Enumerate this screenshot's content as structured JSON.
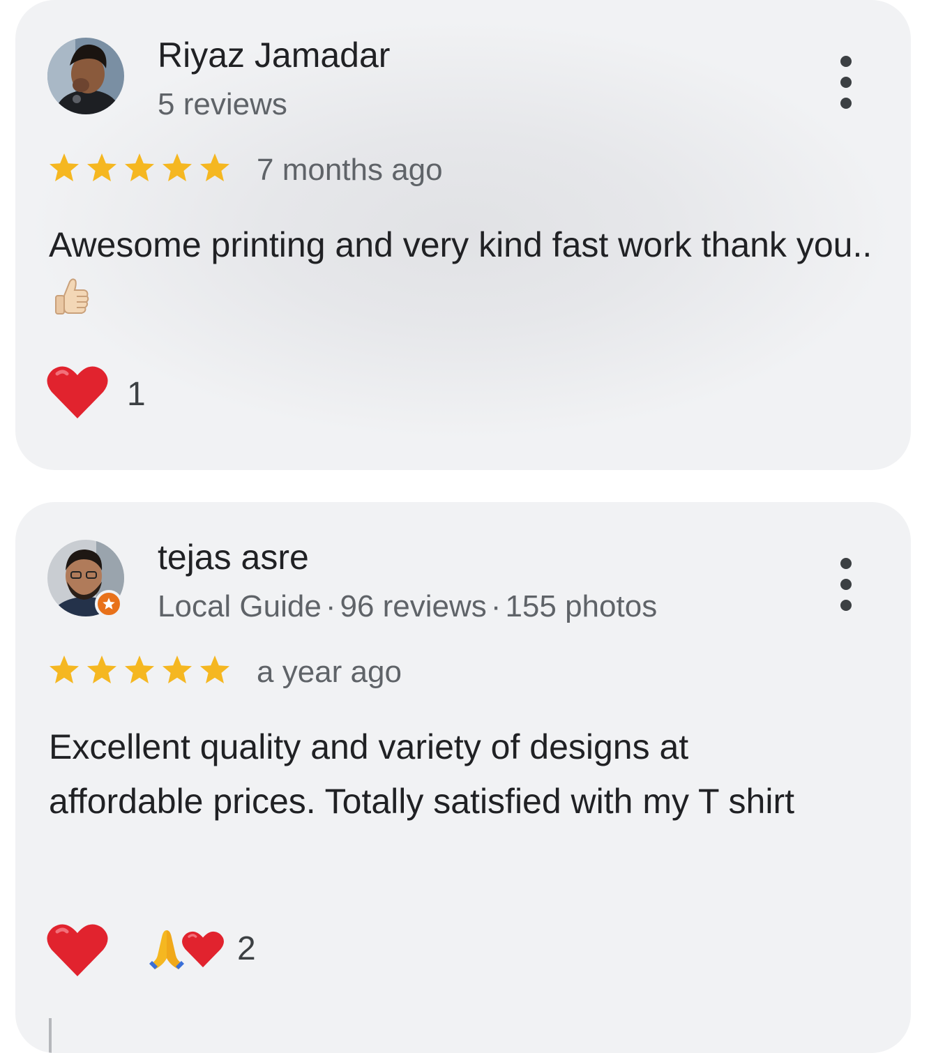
{
  "reviews": [
    {
      "author": "Riyaz Jamadar",
      "meta": {
        "reviews": "5 reviews"
      },
      "rating": 5,
      "time": "7 months ago",
      "text": "Awesome printing and very kind fast work thank you..",
      "text_emoji": "thumbs-up",
      "reactions": {
        "count": "1",
        "icons": [
          "red-heart"
        ]
      }
    },
    {
      "author": "tejas asre",
      "meta": {
        "local_guide": "Local Guide",
        "reviews": "96 reviews",
        "photos": "155 photos",
        "separator": "·"
      },
      "rating": 5,
      "time": "a year ago",
      "text": "Excellent quality and variety of designs at affordable prices. Totally satisfied with my T shirt",
      "reactions": {
        "count": "2",
        "icons": [
          "folded-hands",
          "red-heart"
        ]
      }
    }
  ],
  "colors": {
    "star": "#f5b721",
    "heart": "#e1232e",
    "local_guide_badge": "#e8711a",
    "text_primary": "#202124",
    "text_secondary": "#5f6368"
  }
}
